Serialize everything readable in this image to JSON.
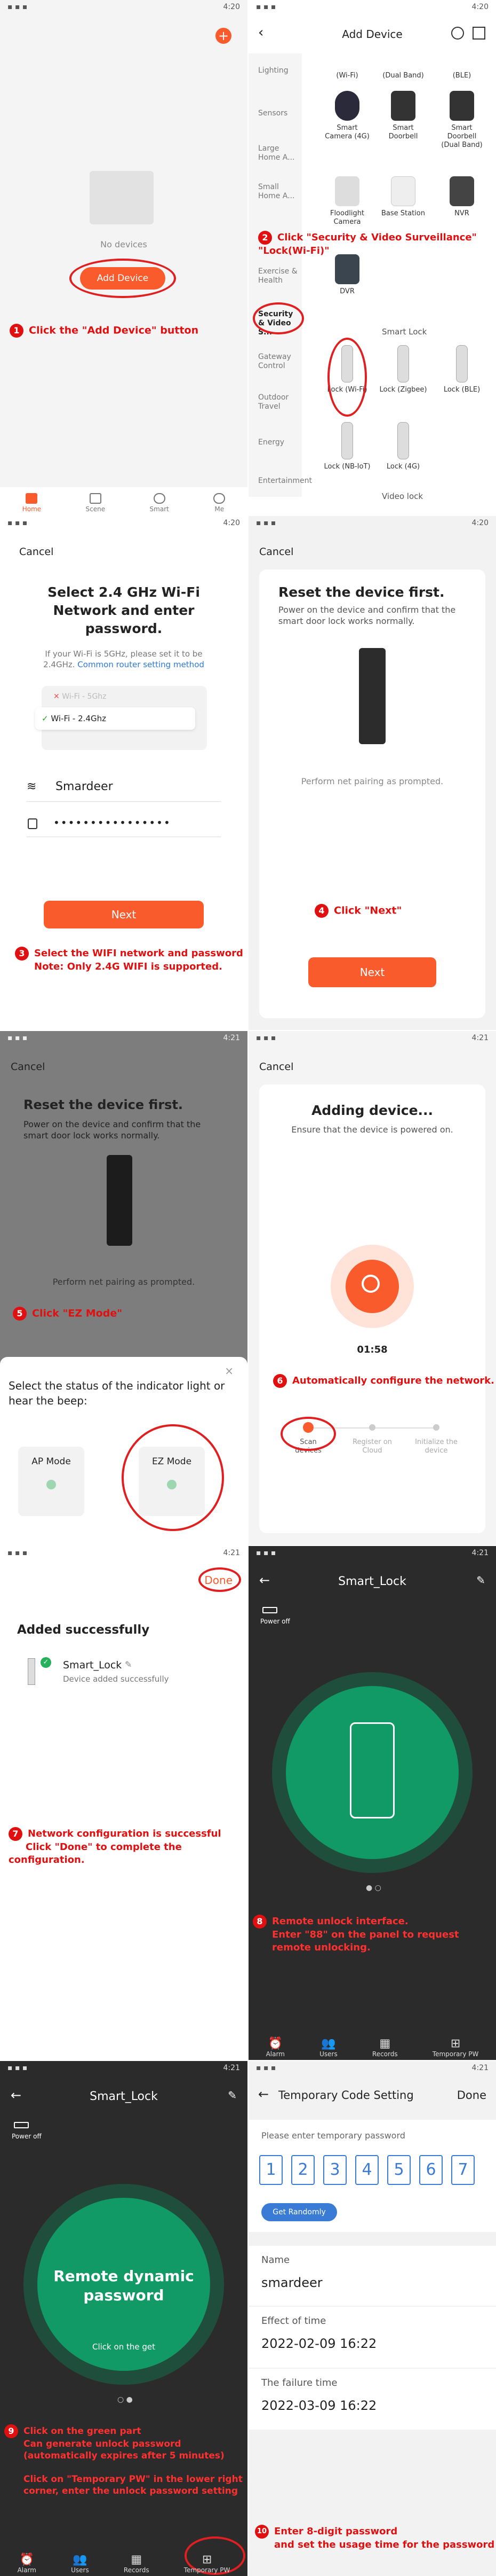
{
  "status": {
    "time1": "4:20",
    "time2": "4:20",
    "time3": "4:20",
    "time4": "4:20",
    "time5": "4:21",
    "time6": "4:21",
    "time7": "4:21",
    "time8": "4:21",
    "time9": "4:21",
    "time10": "4:21"
  },
  "p1": {
    "no_devices": "No devices",
    "add_device": "Add Device",
    "tabs": [
      "Home",
      "Scene",
      "Smart",
      "Me"
    ],
    "ann_num": "1",
    "ann": "Click the \"Add Device\" button"
  },
  "p2": {
    "title": "Add Device",
    "categories": [
      "Lighting",
      "Sensors",
      "Large Home A...",
      "Small Home A...",
      "Exercise & Health",
      "Security & Video S...",
      "Gateway Control",
      "Outdoor Travel",
      "Energy",
      "Entertainment"
    ],
    "top_labels": [
      "(Wi-Fi)",
      "(Dual Band)",
      "(BLE)"
    ],
    "row1": [
      "Smart Camera (4G)",
      "Smart Doorbell",
      "Smart Doorbell (Dual Band)"
    ],
    "row2": [
      "Floodlight Camera",
      "Base Station",
      "NVR"
    ],
    "row3": [
      "DVR"
    ],
    "smart_lock": "Smart Lock",
    "locks": [
      "Lock (Wi-Fi)",
      "Lock (Zigbee)",
      "Lock (BLE)"
    ],
    "locks2": [
      "Lock (NB-IoT)",
      "Lock (4G)"
    ],
    "video_lock": "Video lock",
    "ann_num": "2",
    "ann": "Click \"Security & Video Surveillance\" \"Lock(Wi-Fi)\""
  },
  "p3": {
    "cancel": "Cancel",
    "title": "Select 2.4 GHz Wi-Fi Network and enter password.",
    "hint": "If your Wi-Fi is 5GHz, please set it to be 2.4GHz.",
    "hint_link": "Common router setting method",
    "wifi5": "Wi-Fi - 5Ghz",
    "wifi24": "Wi-Fi - 2.4Ghz",
    "ssid": "Smardeer",
    "password": "••••••••••••••••",
    "next": "Next",
    "ann_num": "3",
    "ann": "Select the WIFI network and password",
    "ann2": "Note: Only 2.4G WIFI is supported."
  },
  "p4": {
    "cancel": "Cancel",
    "title": "Reset the device first.",
    "desc": "Power on the device and confirm that the smart door lock works normally.",
    "prompt": "Perform net pairing as prompted.",
    "next": "Next",
    "ann_num": "4",
    "ann": "Click \"Next\""
  },
  "p5": {
    "cancel": "Cancel",
    "title": "Reset the device first.",
    "desc": "Power on the device and confirm that the smart door lock works normally.",
    "prompt": "Perform net pairing as prompted.",
    "ann_num": "5",
    "ann": "Click \"EZ Mode\"",
    "sheet_title": "Select the status of the indicator light or hear the beep:",
    "ap": "AP Mode",
    "ez": "EZ Mode"
  },
  "p6": {
    "cancel": "Cancel",
    "title": "Adding device...",
    "desc": "Ensure that the device is powered on.",
    "timer": "01:58",
    "steps": [
      "Scan devices",
      "Register on Cloud",
      "Initialize the device"
    ],
    "ann_num": "6",
    "ann": "Automatically configure the network."
  },
  "p7": {
    "done": "Done",
    "title": "Added successfully",
    "name": "Smart_Lock",
    "sub": "Device added successfully",
    "ann_num": "7",
    "ann": "Network configuration is successful",
    "ann2": "Click \"Done\" to complete the configuration."
  },
  "p8": {
    "title": "Smart_Lock",
    "power": "Power off",
    "tabs": [
      "Alarm",
      "Users",
      "Records",
      "Temporary PW"
    ],
    "ann_num": "8",
    "ann": "Remote unlock interface.",
    "ann2": "Enter \"88\" on the panel to request",
    "ann3": "remote unlocking."
  },
  "p9": {
    "title": "Smart_Lock",
    "power": "Power off",
    "circle1": "Remote dynamic",
    "circle2": "password",
    "click": "Click on the get",
    "tabs": [
      "Alarm",
      "Users",
      "Records",
      "Temporary PW"
    ],
    "ann_num": "9",
    "ann": "Click on the green part",
    "ann2": "Can generate unlock password",
    "ann3": "(automatically expires after 5 minutes)",
    "ann4": "Click on \"Temporary PW\" in the lower right",
    "ann5": "corner, enter the unlock password setting"
  },
  "p10": {
    "title": "Temporary Code Setting",
    "done": "Done",
    "enter": "Please enter temporary password",
    "digits": [
      "1",
      "2",
      "3",
      "4",
      "5",
      "6",
      "7"
    ],
    "random": "Get Randomly",
    "name_lbl": "Name",
    "name_val": "smardeer",
    "eff_lbl": "Effect of time",
    "eff_val": "2022-02-09 16:22",
    "fail_lbl": "The failure time",
    "fail_val": "2022-03-09 16:22",
    "ann_num": "10",
    "ann": "Enter 8-digit password",
    "ann2": "and set the usage time for the password"
  }
}
